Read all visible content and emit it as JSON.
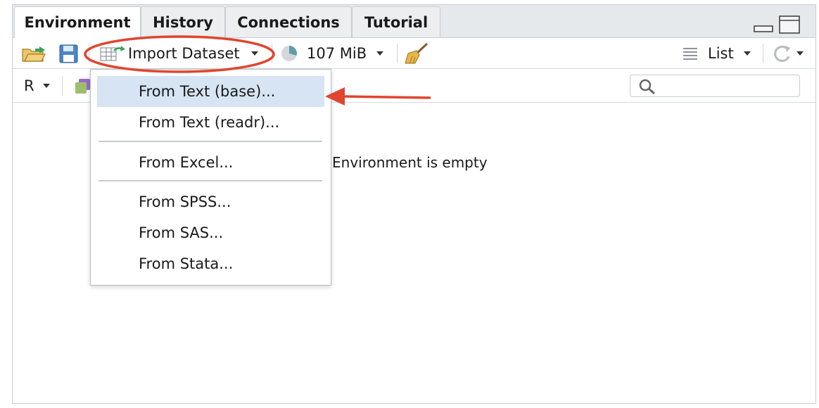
{
  "tabs": [
    "Environment",
    "History",
    "Connections",
    "Tutorial"
  ],
  "toolbar": {
    "import_label": "Import Dataset",
    "memory_label": "107 MiB",
    "view_label": "List"
  },
  "toolbar2": {
    "language_label": "R",
    "search_placeholder": ""
  },
  "environment": {
    "empty_message": "Environment is empty"
  },
  "import_menu": {
    "items": [
      "From Text (base)...",
      "From Text (readr)...",
      "From Excel...",
      "From SPSS...",
      "From SAS...",
      "From Stata..."
    ],
    "highlighted_index": 0
  },
  "annotation_color": "#e0452f",
  "highlight_color": "#d6e4f3"
}
